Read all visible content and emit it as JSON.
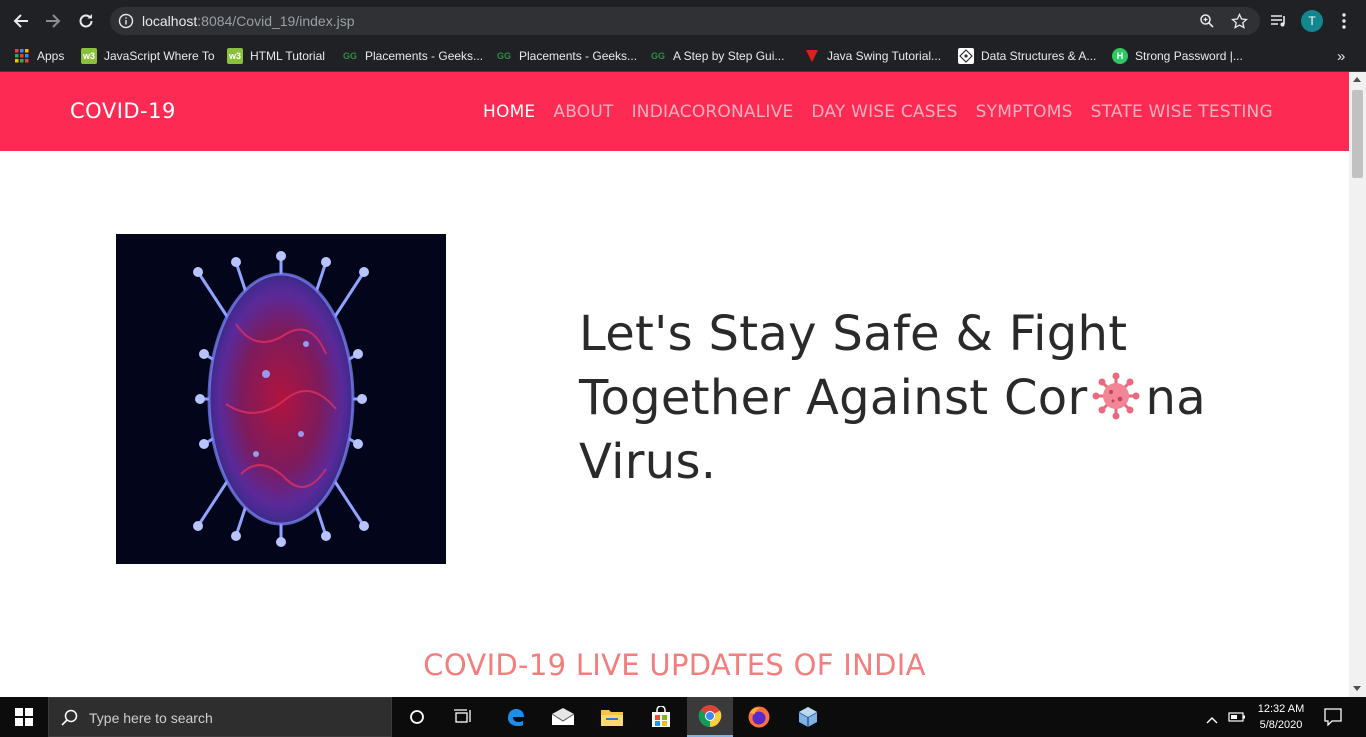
{
  "browser": {
    "url_host": "localhost",
    "url_rest": ":8084/Covid_19/index.jsp",
    "profile_initial": "T",
    "bookmarks": [
      {
        "label": "Apps",
        "icon": "apps-grid-icon"
      },
      {
        "label": "JavaScript Where To",
        "icon": "w3schools-icon"
      },
      {
        "label": "HTML Tutorial",
        "icon": "w3schools-icon"
      },
      {
        "label": "Placements - Geeks...",
        "icon": "geeksforgeeks-icon"
      },
      {
        "label": "Placements - Geeks...",
        "icon": "geeksforgeeks-icon"
      },
      {
        "label": "A Step by Step Gui...",
        "icon": "geeksforgeeks-icon"
      },
      {
        "label": "Java Swing Tutorial...",
        "icon": "javatpoint-icon"
      },
      {
        "label": "Data Structures & A...",
        "icon": "datastructures-icon"
      },
      {
        "label": "Strong Password |...",
        "icon": "hackerrank-icon"
      }
    ],
    "overflow_label": "»"
  },
  "site": {
    "brand": "COVID-19",
    "menu": [
      {
        "label": "HOME",
        "active": true
      },
      {
        "label": "ABOUT",
        "active": false
      },
      {
        "label": "INDIACORONALIVE",
        "active": false
      },
      {
        "label": "DAY WISE CASES",
        "active": false
      },
      {
        "label": "SYMPTOMS",
        "active": false
      },
      {
        "label": "STATE WISE TESTING",
        "active": false
      }
    ],
    "hero": {
      "line1": "Let's Stay Safe & Fight",
      "line2_before": "Together Against Cor",
      "line2_after": "na",
      "line3": "Virus."
    },
    "section_title": "COVID-19 LIVE UPDATES OF INDIA",
    "colors": {
      "navbar": "#fd2b53",
      "section_title": "#f47d7d",
      "hero_text": "#2a2a2a"
    }
  },
  "taskbar": {
    "search_placeholder": "Type here to search",
    "time": "12:32 AM",
    "date": "5/8/2020"
  }
}
